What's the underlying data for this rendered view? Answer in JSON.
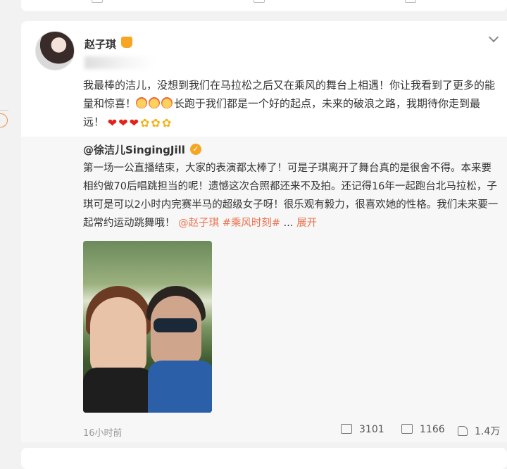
{
  "post": {
    "author": "赵子琪",
    "text_parts": [
      "我最棒的洁儿，没想到我们在马拉松之后又在乘风的舞台上相遇！你让我看到了更多的能量和惊喜！",
      "长跑于我们都是一个好的起点，未来的破浪之路，我期待你走到最远！"
    ],
    "timestamp": "16小时前",
    "reposts": "3101",
    "comments": "1166",
    "likes": "1.4万"
  },
  "repost": {
    "author": "@徐洁儿SingingJill",
    "text": "第一场一公直播结束，大家的表演都太棒了！可是子琪离开了舞台真的是很舍不得。本来要相约做70后唱跳担当的呢！遗憾这次合照都还来不及拍。还记得16年一起跑台北马拉松，子琪可是可以2小时内完赛半马的超级女子呀！很乐观有毅力，很喜欢她的性格。我们未来要一起常约运动跳舞哦！",
    "mention": "@赵子琪",
    "hashtag": "#乘风时刻#",
    "ellipsis": "...",
    "expand": "展开"
  },
  "colors": {
    "link": "#eb7350",
    "accent": "#f5a623"
  },
  "icons": [
    "chevron-down-icon",
    "verified-icon",
    "repost-icon",
    "comment-icon",
    "like-icon"
  ]
}
